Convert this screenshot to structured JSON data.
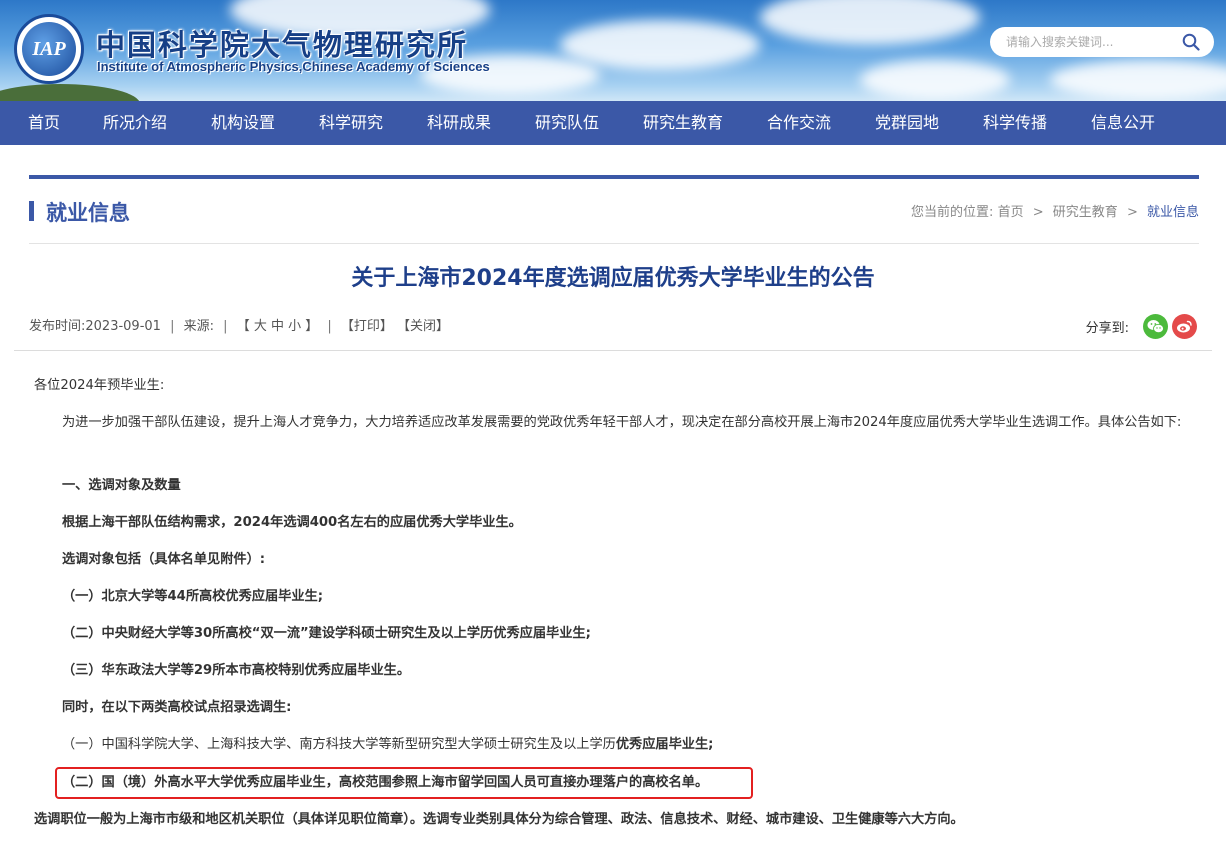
{
  "header": {
    "logo_text": "IAP",
    "title_cn": "中国科学院大气物理研究所",
    "title_en": "Institute of Atmospheric Physics,Chinese Academy of Sciences",
    "search_placeholder": "请输入搜索关键词..."
  },
  "nav": {
    "items": [
      {
        "label": "首页"
      },
      {
        "label": "所况介绍"
      },
      {
        "label": "机构设置"
      },
      {
        "label": "科学研究"
      },
      {
        "label": "科研成果"
      },
      {
        "label": "研究队伍"
      },
      {
        "label": "研究生教育"
      },
      {
        "label": "合作交流"
      },
      {
        "label": "党群园地"
      },
      {
        "label": "科学传播"
      },
      {
        "label": "信息公开"
      }
    ]
  },
  "section": {
    "title": "就业信息"
  },
  "breadcrumb": {
    "prefix": "您当前的位置:",
    "home": "首页",
    "parent": "研究生教育",
    "current": "就业信息",
    "separator": ">"
  },
  "article": {
    "title": "关于上海市2024年度选调应届优秀大学毕业生的公告",
    "meta": {
      "publish_label": "发布时间:",
      "publish_date": "2023-09-01",
      "source_label": "来源:",
      "size_label": "【 大 中 小 】",
      "print_label": "【打印】",
      "close_label": "【关闭】",
      "share_label": "分享到:"
    },
    "paragraphs": [
      "各位2024年预毕业生:",
      "为进一步加强干部队伍建设，提升上海人才竞争力，大力培养适应改革发展需要的党政优秀年轻干部人才，现决定在部分高校开展上海市2024年度应届优秀大学毕业生选调工作。具体公告如下:",
      "一、选调对象及数量",
      "根据上海干部队伍结构需求，2024年选调400名左右的应届优秀大学毕业生。",
      "选调对象包括（具体名单见附件）:",
      "（一）北京大学等44所高校优秀应届毕业生;",
      "（二）中央财经大学等30所高校“双一流”建设学科硕士研究生及以上学历优秀应届毕业生;",
      "（三）华东政法大学等29所本市高校特别优秀应届毕业生。",
      "同时，在以下两类高校试点招录选调生:",
      "（一）中国科学院大学、上海科技大学、南方科技大学等新型研究型大学硕士研究生及以上学历",
      "优秀应届毕业生;",
      "（二）国（境）外高水平大学优秀应届毕业生，高校范围参照上海市留学回国人员可直接办理落户的高校名单。",
      "选调职位一般为上海市市级和地区机关职位（具体详见职位简章）。选调专业类别具体分为综合管理、政法、信息技术、财经、城市建设、卫生健康等六大方向。"
    ]
  },
  "colors": {
    "brand": "#3b58a7",
    "title": "#1e3f8a",
    "highlight": "#e32020"
  }
}
